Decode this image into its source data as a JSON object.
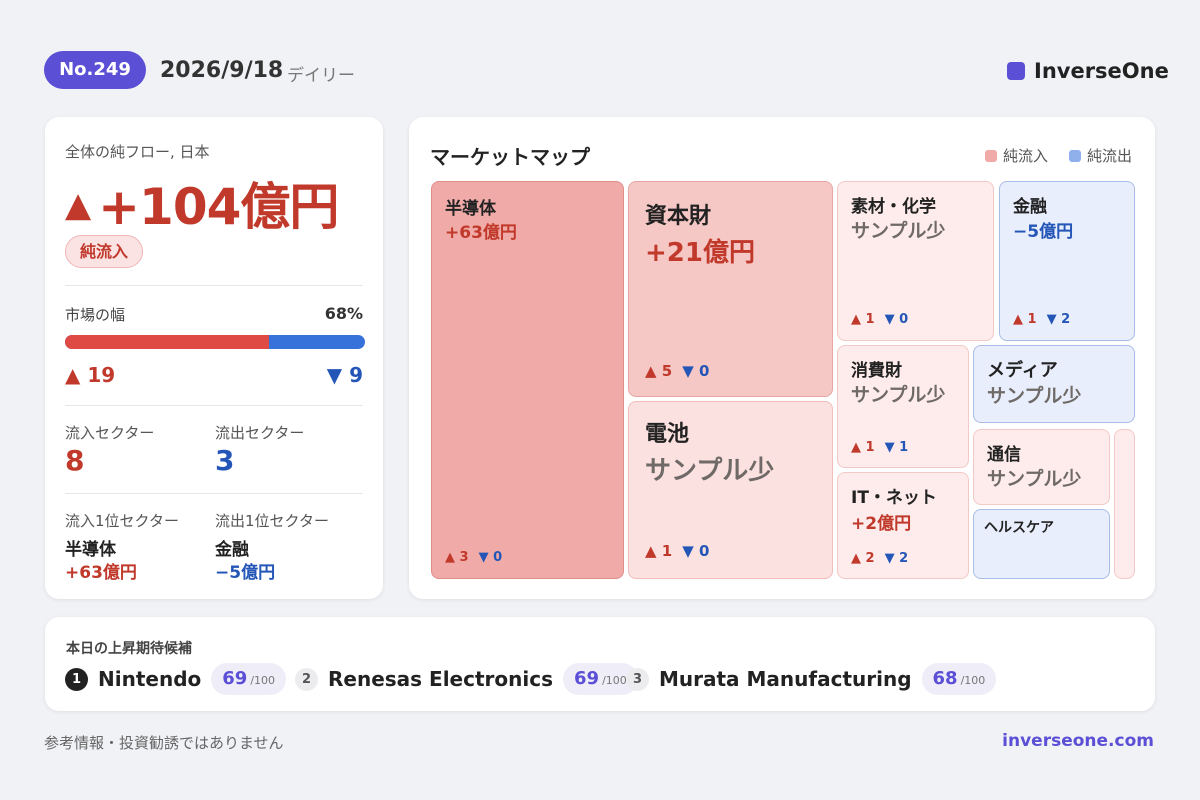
{
  "header": {
    "issue": "No.249",
    "date": "2026/9/18",
    "frequency": "デイリー",
    "brand": "InverseOne",
    "brand_color": "#5b4fd6"
  },
  "summary": {
    "label": "全体の純フロー, 日本",
    "arrow": "▲",
    "value": "+104億円",
    "pill": "純流入",
    "breadth_label": "市場の幅",
    "breadth_pct": "68%",
    "breadth_fraction": 0.68,
    "up_count": "▲ 19",
    "down_count": "▼ 9",
    "inflow_sectors_label": "流入セクター",
    "inflow_sectors": "8",
    "outflow_sectors_label": "流出セクター",
    "outflow_sectors": "3",
    "top_inflow_label": "流入1位セクター",
    "top_inflow_name": "半導体",
    "top_inflow_value": "+63億円",
    "top_outflow_label": "流出1位セクター",
    "top_outflow_name": "金融",
    "top_outflow_value": "−5億円"
  },
  "market_map": {
    "title": "マーケットマップ",
    "legend_inflow": "純流入",
    "legend_outflow": "純流出",
    "legend_inflow_color": "#f0aaa7",
    "legend_outflow_color": "#8fb0ea",
    "tiles": {
      "semis": {
        "name": "半導体",
        "value": "+63億円",
        "up": "▲ 3",
        "down": "▼ 0"
      },
      "capital": {
        "name": "資本財",
        "value": "+21億円",
        "up": "▲ 5",
        "down": "▼ 0"
      },
      "battery": {
        "name": "電池",
        "value": "サンプル少",
        "up": "▲ 1",
        "down": "▼ 0"
      },
      "materials": {
        "name": "素材・化学",
        "value": "サンプル少",
        "up": "▲ 1",
        "down": "▼ 0"
      },
      "finance": {
        "name": "金融",
        "value": "−5億円",
        "up": "▲ 1",
        "down": "▼ 2"
      },
      "consumer": {
        "name": "消費財",
        "value": "サンプル少",
        "up": "▲ 1",
        "down": "▼ 1"
      },
      "media": {
        "name": "メディア",
        "value": "サンプル少"
      },
      "it": {
        "name": "IT・ネット",
        "value": "+2億円",
        "up": "▲ 2",
        "down": "▼ 2"
      },
      "telecom": {
        "name": "通信",
        "value": "サンプル少"
      },
      "health": {
        "name": "ヘルスケア"
      }
    }
  },
  "candidates": {
    "label": "本日の上昇期待候補",
    "items": [
      {
        "rank": "1",
        "name": "Nintendo",
        "score": "69",
        "max": "/100"
      },
      {
        "rank": "2",
        "name": "Renesas Electronics",
        "score": "69",
        "max": "/100"
      },
      {
        "rank": "3",
        "name": "Murata Manufacturing",
        "score": "68",
        "max": "/100"
      }
    ]
  },
  "footer": {
    "disclaimer": "参考情報・投資勧誘ではありません",
    "site": "inverseone.com"
  }
}
